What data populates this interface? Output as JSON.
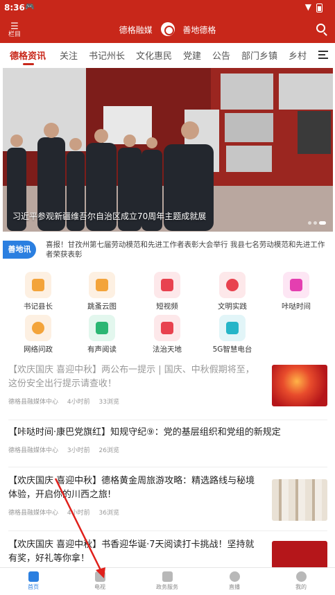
{
  "status_bar": {
    "time": "8:36",
    "game_icon": "gamepad-icon",
    "wifi_icon": "wifi-icon",
    "battery_icon": "battery-icon"
  },
  "header": {
    "menu_label": "栏目",
    "brand_left": "德格融媒",
    "brand_right": "善地德格",
    "search_icon": "search-icon",
    "background_color": "#c8271a"
  },
  "tabs": [
    "德格资讯",
    "关注",
    "书记州长",
    "文化惠民",
    "党建",
    "公告",
    "部门乡镇",
    "乡村"
  ],
  "active_tab": 0,
  "banner": {
    "caption": "习近平参观新疆维吾尔自治区成立70周年主题成就展",
    "page_dots": 3,
    "active_dot": 2
  },
  "ticker": {
    "badge": "善地讯",
    "text": "喜报！甘孜州第七届劳动模范和先进工作者表彰大会举行 我县七名劳动模范和先进工作者荣获表彰"
  },
  "grid_menu": [
    {
      "label": "书记县长",
      "icon": "document-icon",
      "bg": "#fdf0e2",
      "fg": "#f3a43b"
    },
    {
      "label": "跳蚤云图",
      "icon": "picture-icon",
      "bg": "#fdf0e2",
      "fg": "#f3a43b"
    },
    {
      "label": "短视频",
      "icon": "video-icon",
      "bg": "#fde8ea",
      "fg": "#e8424f"
    },
    {
      "label": "文明实践",
      "icon": "heart-icon",
      "bg": "#fde8ea",
      "fg": "#e8424f"
    },
    {
      "label": "咔哒时间",
      "icon": "megaphone-icon",
      "bg": "#fde6f4",
      "fg": "#e43fb0"
    },
    {
      "label": "网络问政",
      "icon": "chat-icon",
      "bg": "#fdf0e2",
      "fg": "#f3a43b"
    },
    {
      "label": "有声阅读",
      "icon": "graduation-cap-icon",
      "bg": "#e3f7ee",
      "fg": "#2bb673"
    },
    {
      "label": "法治天地",
      "icon": "flag-icon",
      "bg": "#fde8ea",
      "fg": "#e8424f"
    },
    {
      "label": "5G智慧电台",
      "icon": "live-icon",
      "bg": "#e2f5f8",
      "fg": "#26b5c8"
    }
  ],
  "news": [
    {
      "title": "【欢庆国庆 喜迎中秋】两公布一提示 | 国庆、中秋假期将至，这份安全出行提示请查收！",
      "source": "德格县融媒体中心",
      "time": "4小时前",
      "views": "33浏览",
      "has_thumb": true
    },
    {
      "title": "【咔哒时间·康巴党旗红】知规守纪⑨：党的基层组织和党组的新规定",
      "source": "德格县融媒体中心",
      "time": "3小时前",
      "views": "26浏览",
      "has_thumb": false
    },
    {
      "title": "【欢庆国庆 喜迎中秋】德格黄金周旅游攻略：精选路线与秘境体验，开启你的川西之旅!",
      "source": "德格县融媒体中心",
      "time": "4小时前",
      "views": "36浏览",
      "has_thumb": true
    },
    {
      "title": "【欢庆国庆 喜迎中秋】书香迎华诞·7天阅读打卡挑战！坚持就有奖，好礼等你拿！",
      "source": "",
      "time": "",
      "views": "",
      "has_thumb": true
    }
  ],
  "bottom_nav": [
    {
      "label": "首页",
      "icon": "home-icon"
    },
    {
      "label": "电视",
      "icon": "tv-icon"
    },
    {
      "label": "政务服务",
      "icon": "grid-icon"
    },
    {
      "label": "直播",
      "icon": "play-icon"
    },
    {
      "label": "我的",
      "icon": "profile-icon"
    }
  ],
  "active_nav": 0,
  "colors": {
    "accent": "#c8271a",
    "blue": "#2b7fe0"
  }
}
